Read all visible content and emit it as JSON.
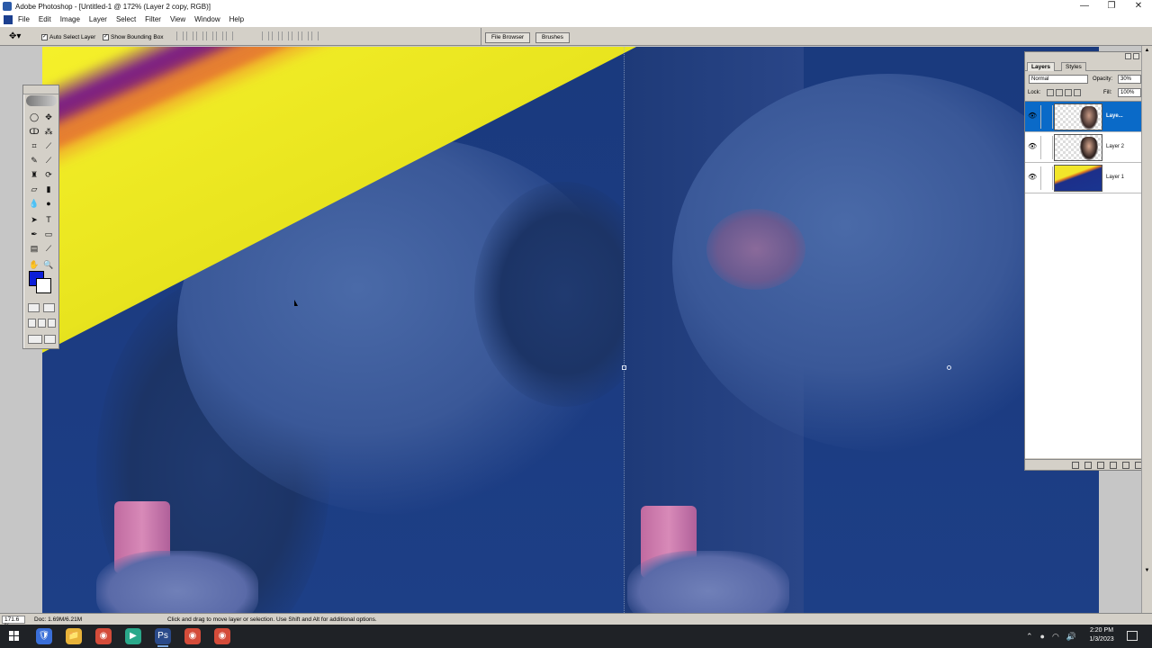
{
  "window": {
    "title": "Adobe Photoshop - [Untitled-1 @ 172% (Layer 2 copy, RGB)]",
    "controls": [
      "—",
      "❐",
      "✕"
    ]
  },
  "menu": [
    "File",
    "Edit",
    "Image",
    "Layer",
    "Select",
    "Filter",
    "View",
    "Window",
    "Help"
  ],
  "options_bar": {
    "tool_glyph": "✥▾",
    "auto_select_layer": {
      "label": "Auto Select Layer",
      "checked": true
    },
    "show_bounding_box": {
      "label": "Show Bounding Box",
      "checked": true
    },
    "palette_well_tabs": [
      "File Browser",
      "Brushes"
    ]
  },
  "toolbox": {
    "tools": [
      {
        "name": "marquee-tool-icon",
        "glyph": "◯"
      },
      {
        "name": "move-tool-icon",
        "glyph": "✥"
      },
      {
        "name": "lasso-tool-icon",
        "glyph": "ↀ"
      },
      {
        "name": "magic-wand-icon",
        "glyph": "⁂"
      },
      {
        "name": "crop-tool-icon",
        "glyph": "⌗"
      },
      {
        "name": "slice-tool-icon",
        "glyph": "⟋"
      },
      {
        "name": "healing-brush-icon",
        "glyph": "✎"
      },
      {
        "name": "brush-tool-icon",
        "glyph": "⟋"
      },
      {
        "name": "clone-stamp-icon",
        "glyph": "♜"
      },
      {
        "name": "history-brush-icon",
        "glyph": "⟳"
      },
      {
        "name": "eraser-tool-icon",
        "glyph": "▱"
      },
      {
        "name": "gradient-tool-icon",
        "glyph": "▮"
      },
      {
        "name": "blur-tool-icon",
        "glyph": "💧"
      },
      {
        "name": "dodge-tool-icon",
        "glyph": "●"
      },
      {
        "name": "path-select-icon",
        "glyph": "➤"
      },
      {
        "name": "type-tool-icon",
        "glyph": "T"
      },
      {
        "name": "pen-tool-icon",
        "glyph": "✒"
      },
      {
        "name": "shape-tool-icon",
        "glyph": "▭"
      },
      {
        "name": "notes-tool-icon",
        "glyph": "▤"
      },
      {
        "name": "eyedropper-tool-icon",
        "glyph": "⟋"
      },
      {
        "name": "hand-tool-icon",
        "glyph": "✋"
      },
      {
        "name": "zoom-tool-icon",
        "glyph": "🔍"
      }
    ],
    "foreground_color": "#0b1ed8",
    "background_color": "#ffffff"
  },
  "layers_palette": {
    "tabs": [
      "Layers",
      "Styles"
    ],
    "blend_mode": "Normal",
    "opacity_label": "Opacity:",
    "opacity_value": "30%",
    "lock_label": "Lock:",
    "fill_label": "Fill:",
    "fill_value": "100%",
    "layers": [
      {
        "name": "Laye...",
        "selected": true,
        "visible": true,
        "thumb": "transparent-portrait"
      },
      {
        "name": "Layer 2",
        "selected": false,
        "visible": true,
        "thumb": "portrait"
      },
      {
        "name": "Layer 1",
        "selected": false,
        "visible": true,
        "thumb": "color-fill"
      }
    ]
  },
  "status_bar": {
    "zoom": "171.6 %",
    "doc_size": "Doc: 1.69M/6.21M",
    "hint": "Click and drag to move layer or selection.  Use Shift and Alt for additional options."
  },
  "taskbar": {
    "apps": [
      {
        "name": "shield-app-icon",
        "glyph": "🛡",
        "color": "#3a6fd8"
      },
      {
        "name": "file-explorer-icon",
        "glyph": "📁",
        "color": "#e8b33a"
      },
      {
        "name": "chrome-icon-1",
        "glyph": "◉",
        "color": "#d44c3a"
      },
      {
        "name": "terminal-icon",
        "glyph": "▶",
        "color": "#2aa88a"
      },
      {
        "name": "photoshop-taskbar-icon",
        "glyph": "Ps",
        "color": "#2a4a8a"
      },
      {
        "name": "chrome-icon-2",
        "glyph": "◉",
        "color": "#d44c3a"
      },
      {
        "name": "chrome-icon-3",
        "glyph": "◉",
        "color": "#d44c3a"
      }
    ],
    "clock_time": "2:20 PM",
    "clock_date": "1/3/2023"
  }
}
